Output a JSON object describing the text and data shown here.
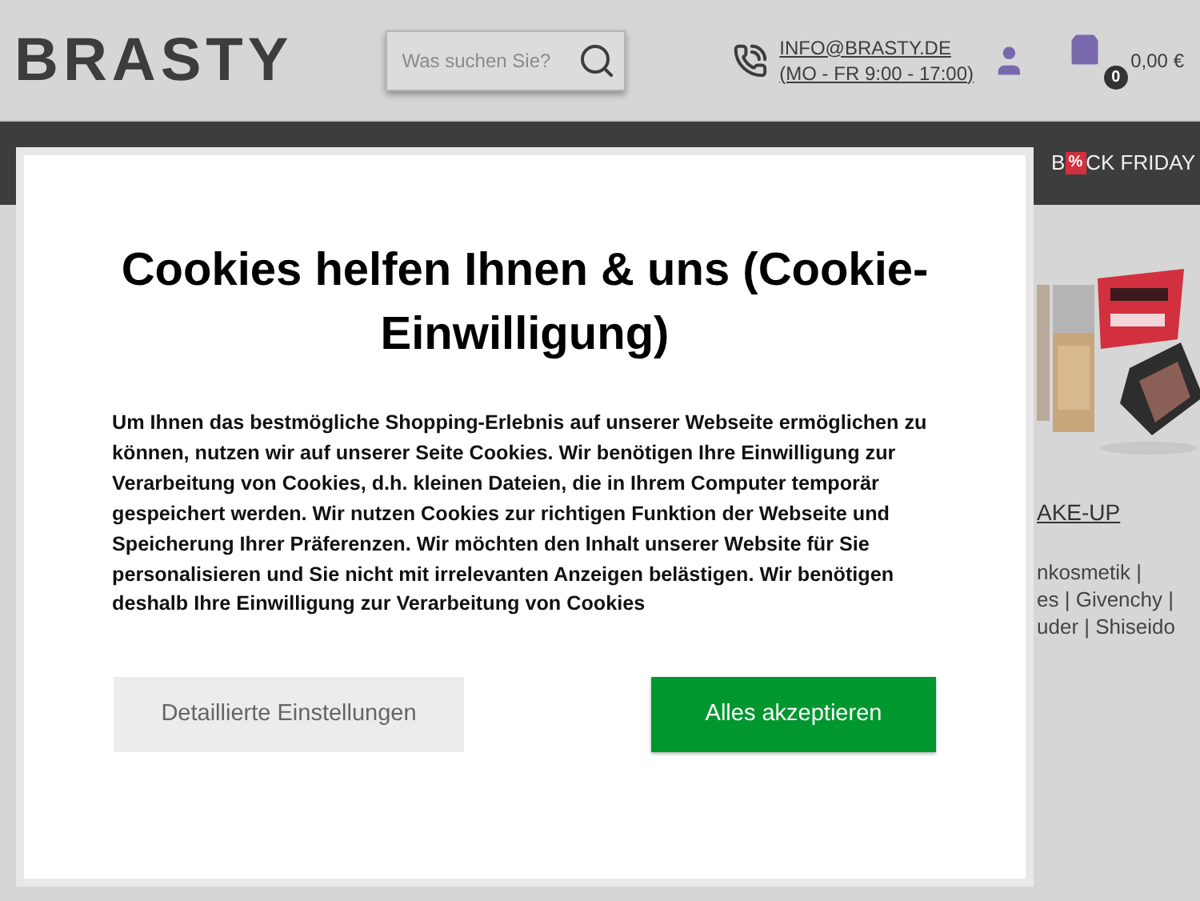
{
  "header": {
    "logo": "BRASTY",
    "search": {
      "placeholder": "Was suchen Sie?"
    },
    "contact": {
      "email": "INFO@BRASTY.DE",
      "hours": "(MO - FR 9:00 - 17:00)"
    },
    "cart": {
      "count": "0",
      "total": "0,00 €"
    }
  },
  "nav": {
    "visible_item": {
      "start": "B",
      "badge": "%",
      "end": "CK FRIDAY"
    }
  },
  "promo": {
    "heading": "AKE-UP",
    "lines": [
      "nkosmetik |",
      "es | Givenchy |",
      "uder | Shiseido"
    ]
  },
  "cookie_dialog": {
    "title": "Cookies helfen Ihnen & uns (Cookie-Einwilligung)",
    "body": "Um Ihnen das bestmögliche Shopping-Erlebnis auf unserer Webseite ermöglichen zu können, nutzen wir auf unserer Seite Cookies. Wir benötigen Ihre Einwilligung zur Verarbeitung von Cookies, d.h. kleinen Dateien, die in Ihrem Computer temporär gespeichert werden. Wir nutzen Cookies zur richtigen Funktion der Webseite und Speicherung Ihrer Präferenzen. Wir möchten den Inhalt unserer Website für Sie personalisieren und Sie nicht mit irrelevanten Anzeigen belästigen. Wir benötigen deshalb Ihre Einwilligung zur Verarbeitung von Cookies",
    "buttons": [
      {
        "label": "Detaillierte Einstellungen",
        "kind": "secondary"
      },
      {
        "label": "Alles akzeptieren",
        "kind": "primary"
      }
    ]
  }
}
